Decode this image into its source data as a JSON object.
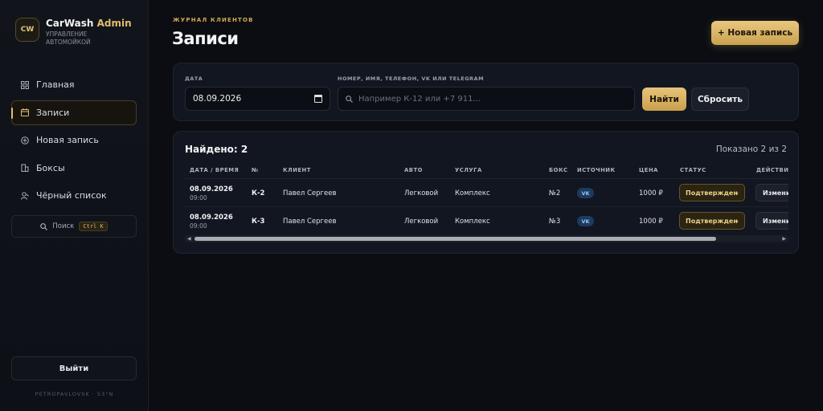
{
  "brand": {
    "logo": "CW",
    "title_main": "CarWash",
    "title_accent": "Admin",
    "subtitle": "УПРАВЛЕНИЕ АВТОМОЙКОЙ"
  },
  "sidebar": {
    "items": [
      {
        "label": "Главная",
        "icon": "grid-icon",
        "active": false
      },
      {
        "label": "Записи",
        "icon": "calendar-icon",
        "active": true
      },
      {
        "label": "Новая запись",
        "icon": "plus-circle-icon",
        "active": false
      },
      {
        "label": "Боксы",
        "icon": "building-icon",
        "active": false
      },
      {
        "label": "Чёрный список",
        "icon": "user-block-icon",
        "active": false
      }
    ],
    "search_label": "Поиск",
    "search_shortcut": "Ctrl K",
    "logout_label": "Выйти",
    "location": "PETROPAVLOVSK · 53°N"
  },
  "header": {
    "eyebrow": "ЖУРНАЛ КЛИЕНТОВ",
    "title": "Записи",
    "new_button": "+ Новая запись"
  },
  "filters": {
    "date_label": "ДАТА",
    "date_value": "08.09.2026",
    "query_label": "НОМЕР, ИМЯ, ТЕЛЕФОН, VK ИЛИ TELEGRAM",
    "query_placeholder": "Например К-12 или +7 911...",
    "find_button": "Найти",
    "reset_button": "Сбросить"
  },
  "results": {
    "found": "Найдено: 2",
    "shown": "Показано 2 из 2",
    "columns": [
      "ДАТА / ВРЕМЯ",
      "№",
      "КЛИЕНТ",
      "АВТО",
      "УСЛУГА",
      "БОКС",
      "ИСТОЧНИК",
      "ЦЕНА",
      "СТАТУС",
      "ДЕЙСТВИЯ"
    ],
    "rows": [
      {
        "date": "08.09.2026",
        "time": "09:00",
        "num": "К-2",
        "client": "Павел Сергеев",
        "car": "Легковой",
        "service": "Комплекс",
        "box": "№2",
        "source": "VK",
        "price": "1000 ₽",
        "status": "Подтвержден",
        "action": "Изменить"
      },
      {
        "date": "08.09.2026",
        "time": "09:00",
        "num": "К-3",
        "client": "Павел Сергеев",
        "car": "Легковой",
        "service": "Комплекс",
        "box": "№3",
        "source": "VK",
        "price": "1000 ₽",
        "status": "Подтвержден",
        "action": "Изменить"
      }
    ]
  },
  "colors": {
    "accent": "#e2bd6e",
    "background": "#0b0d12",
    "card": "#121620"
  }
}
